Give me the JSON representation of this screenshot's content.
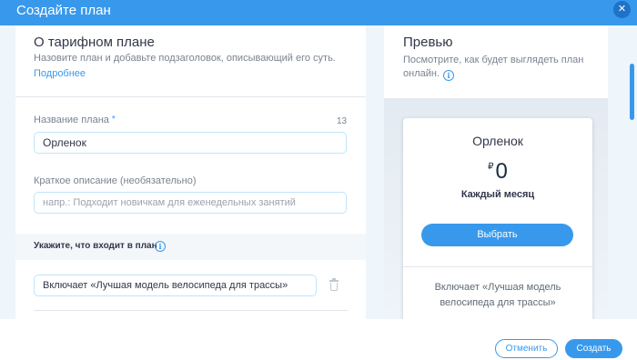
{
  "header": {
    "title": "Создайте план",
    "close_icon": "close-icon"
  },
  "about": {
    "title": "О тарифном плане",
    "description": "Назовите план и добавьте подзаголовок, описывающий его суть.",
    "learn_more_link": "Подробнее"
  },
  "plan_name": {
    "label": "Название плана",
    "required_mark": "*",
    "char_count": "13",
    "value": "Орленок"
  },
  "short_description": {
    "label": "Краткое описание (необязательно)",
    "placeholder": "напр.: Подходит новичкам для еженедельных занятий"
  },
  "includes": {
    "title": "Укажите, что входит в план",
    "info_icon": "info-icon",
    "items": [
      {
        "value": "Включает «Лучшая модель велосипеда для трассы»",
        "delete_icon": "trash-icon"
      }
    ]
  },
  "preview": {
    "title": "Превью",
    "description": "Посмотрите, как будет выглядеть план онлайн.",
    "info_icon": "info-icon",
    "card": {
      "plan_name": "Орленок",
      "currency": "₽",
      "price": "0",
      "period": "Каждый месяц",
      "select_button": "Выбрать",
      "benefit": "Включает «Лучшая модель велосипеда для трассы»"
    }
  },
  "footer": {
    "cancel_button": "Отменить",
    "create_button": "Создать"
  },
  "colors": {
    "accent": "#3899ec",
    "header": "#3899ec",
    "text": "#32364a",
    "muted": "#7a8391",
    "canvas": "#eef5fb"
  }
}
